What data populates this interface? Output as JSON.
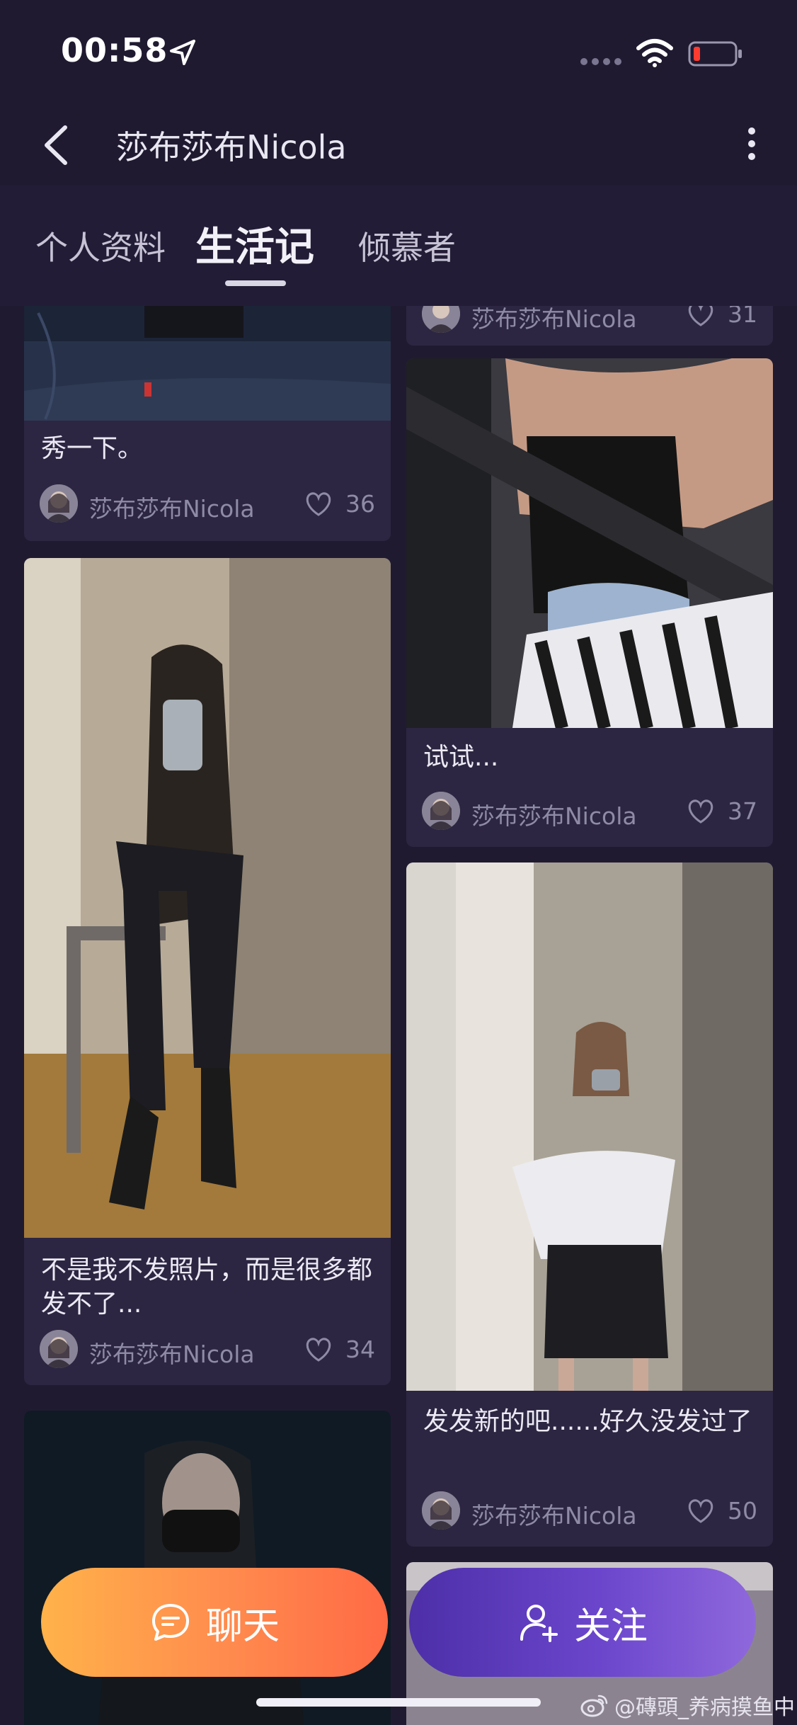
{
  "status_bar": {
    "time": "00:58"
  },
  "nav": {
    "title": "莎布莎布Nicola"
  },
  "tabs": [
    {
      "label": "个人资料"
    },
    {
      "label": "生活记"
    },
    {
      "label": "倾慕者"
    }
  ],
  "active_tab": "生活记",
  "posts": [
    {
      "caption": "秀一下。",
      "author": "莎布莎布Nicola",
      "likes": "36"
    },
    {
      "caption": "不是我不发照片，而是很多都发不了...",
      "author": "莎布莎布Nicola",
      "likes": "34"
    },
    {
      "caption": "",
      "author": "莎布莎布Nicola",
      "likes": "31"
    },
    {
      "caption": "试试...",
      "author": "莎布莎布Nicola",
      "likes": "37"
    },
    {
      "caption": "发发新的吧......好久没发过了",
      "author": "莎布莎布Nicola",
      "likes": "50"
    }
  ],
  "actions": {
    "chat_label": "聊天",
    "follow_label": "关注"
  },
  "watermark": "@磚頭_养病摸鱼中",
  "colors": {
    "background": "#201a31",
    "card": "#2c2642",
    "chat_gradient_start": "#ffb24a",
    "chat_gradient_end": "#ff6a45",
    "follow_gradient_start": "#4d2fa8",
    "follow_gradient_end": "#8f68dc"
  }
}
